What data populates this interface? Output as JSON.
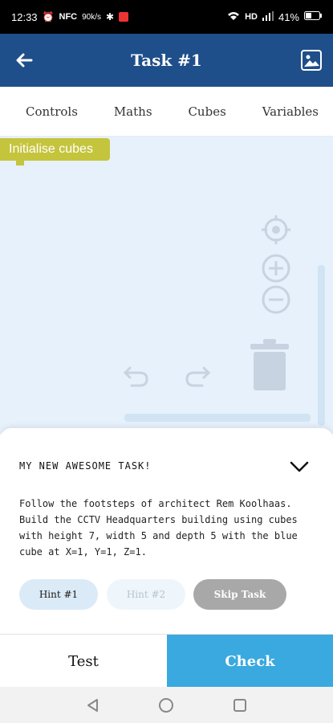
{
  "status_bar": {
    "time": "12:33",
    "left_icons": [
      "alarm-icon",
      "NFC",
      "90k/s",
      "bluetooth-icon",
      "app-icon"
    ],
    "nfc": "NFC",
    "speed": "90k/s",
    "right_icons": [
      "wifi-icon",
      "HD",
      "signal-icon",
      "41%",
      "battery-icon"
    ],
    "hd": "HD",
    "battery": "41%"
  },
  "app_bar": {
    "title": "Task #1"
  },
  "tabs": [
    {
      "label": "Controls"
    },
    {
      "label": "Maths"
    },
    {
      "label": "Cubes"
    },
    {
      "label": "Variables"
    }
  ],
  "workspace": {
    "block_label": "Initialise cubes"
  },
  "task": {
    "title": "MY NEW AWESOME TASK!",
    "description": "Follow the footsteps of architect Rem Koolhaas. Build the CCTV Headquarters building using cubes with height 7, width 5 and depth 5 with the blue cube at X=1, Y=1, Z=1.",
    "hint1": "Hint #1",
    "hint2": "Hint #2",
    "skip": "Skip Task"
  },
  "actions": {
    "test": "Test",
    "check": "Check"
  },
  "colors": {
    "app_bar": "#1f4f8a",
    "workspace": "#e6f1fb",
    "block": "#c5c43d",
    "check": "#3aa9df"
  }
}
